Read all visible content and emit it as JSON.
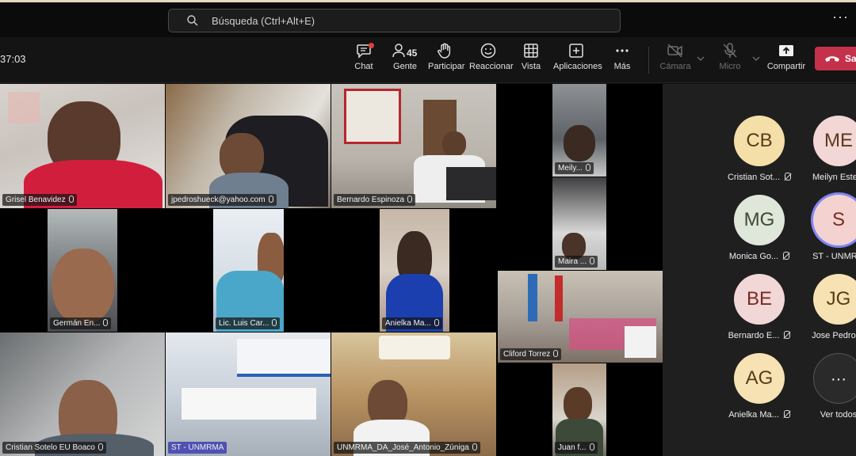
{
  "search": {
    "placeholder": "Búsqueda (Ctrl+Alt+E)",
    "icon": "search-icon"
  },
  "top_more": "···",
  "meeting": {
    "timer": "37:03"
  },
  "toolbar": {
    "chat": "Chat",
    "people": "Gente",
    "people_count": "45",
    "raise": "Participar",
    "react": "Reaccionar",
    "view": "Vista",
    "apps": "Aplicaciones",
    "more": "Más",
    "camera": "Cámara",
    "mic": "Micro",
    "share": "Compartir",
    "leave": "Sa",
    "leave_color": "#c4314b"
  },
  "tiles": [
    {
      "name": "Grisel Benavidez"
    },
    {
      "name": "jpedroshueck@yahoo.com"
    },
    {
      "name": "Bernardo Espinoza"
    },
    {
      "name": "Meily..."
    },
    {
      "name": "Germán En..."
    },
    {
      "name": "Lic. Luis Car..."
    },
    {
      "name": "Anielka Ma..."
    },
    {
      "name": "Maira ..."
    },
    {
      "name": "Cliford Torrez"
    },
    {
      "name": "Cristian Sotelo EU  Boaco"
    },
    {
      "name": "ST - UNMRMA"
    },
    {
      "name": "UNMRMA_DA_José_Antonio_Zúniga"
    },
    {
      "name": "Juan f..."
    }
  ],
  "roster": [
    {
      "initials": "CB",
      "name": "Cristian Sot...",
      "color": "#f4dfa8"
    },
    {
      "initials": "ME",
      "name": "Meilyn Este...",
      "color": "#f3d6d6"
    },
    {
      "initials": "MG",
      "name": "Monica Go...",
      "color": "#dfe6da"
    },
    {
      "initials": "S",
      "name": "ST - UNMRM",
      "color": "#f4d2cf"
    },
    {
      "initials": "BE",
      "name": "Bernardo E...",
      "color": "#f2d7d7"
    },
    {
      "initials": "JG",
      "name": "Jose Pedro ...",
      "color": "#f6e2b3"
    },
    {
      "initials": "AG",
      "name": "Anielka Ma...",
      "color": "#f6e2b3"
    },
    {
      "initials": "···",
      "name": "Ver todos",
      "color": "#2a2a2a"
    }
  ]
}
